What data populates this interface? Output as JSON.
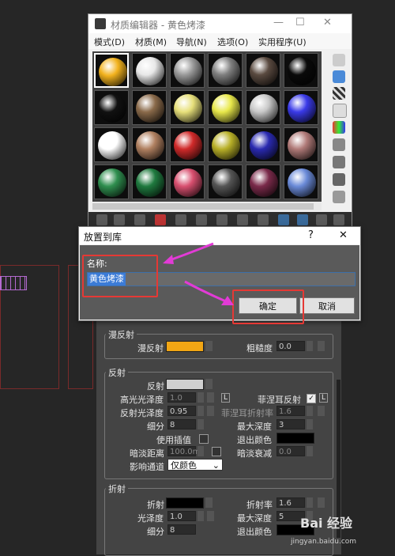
{
  "material_editor": {
    "title": "材质编辑器 - 黄色烤漆",
    "menu": [
      "模式(D)",
      "材质(M)",
      "导航(N)",
      "选项(O)",
      "实用程序(U)"
    ],
    "slots": [
      {
        "color": "#f2b21d",
        "selected": true
      },
      {
        "color": "#e8e8e8"
      },
      {
        "color": "#9a9a9a"
      },
      {
        "color": "#7f7f7f"
      },
      {
        "color": "#5a4a40"
      },
      {
        "color": "#0a0a0a"
      },
      {
        "color": "#111111"
      },
      {
        "color": "#8a6a4a"
      },
      {
        "color": "#e7e07a"
      },
      {
        "color": "#e8e84a"
      },
      {
        "color": "#c8c8c8"
      },
      {
        "color": "#3a3ae8"
      },
      {
        "color": "#ffffff"
      },
      {
        "color": "#b08060"
      },
      {
        "color": "#d02a2a"
      },
      {
        "color": "#b8b028"
      },
      {
        "color": "#2a2ab0"
      },
      {
        "color": "#b07a78"
      },
      {
        "color": "#2f8f4f"
      },
      {
        "color": "#1f7a3f"
      },
      {
        "color": "#d84f6f"
      },
      {
        "color": "#555555"
      },
      {
        "color": "#7a2a4a"
      },
      {
        "color": "#6a8ad8"
      }
    ]
  },
  "dialog": {
    "title": "放置到库",
    "help": "?",
    "close": "✕",
    "name_label": "名称:",
    "name_value": "黄色烤漆",
    "ok": "确定",
    "cancel": "取消"
  },
  "params": {
    "diffuse_group": {
      "title": "漫反射",
      "diffuse_label": "漫反射",
      "diffuse_color": "#f2a614",
      "roughness_label": "粗糙度",
      "roughness_value": "0.0"
    },
    "reflection_group": {
      "title": "反射",
      "reflect_label": "反射",
      "reflect_color": "#cfcfcf",
      "hilight_gloss_label": "高光光泽度",
      "hilight_gloss_value": "1.0",
      "fresnel_label": "菲涅耳反射",
      "refl_gloss_label": "反射光泽度",
      "refl_gloss_value": "0.95",
      "fresnel_ior_label": "菲涅耳折射率",
      "fresnel_ior_value": "1.6",
      "subdivs_label": "细分",
      "subdivs_value": "8",
      "max_depth_label": "最大深度",
      "max_depth_value": "3",
      "use_interp_label": "使用插值",
      "exit_color_label": "退出颜色",
      "dim_dist_label": "暗淡距离",
      "dim_dist_value": "100.0m",
      "dim_falloff_label": "暗淡衰减",
      "dim_falloff_value": "0.0",
      "affect_channels_label": "影响通道",
      "affect_channels_value": "仅颜色"
    },
    "refraction_group": {
      "title": "折射",
      "refract_label": "折射",
      "ior_label": "折射率",
      "ior_value": "1.6",
      "gloss_label": "光泽度",
      "gloss_value": "1.0",
      "max_depth_label": "最大深度",
      "max_depth_value": "5",
      "subdivs_label": "细分",
      "subdivs_value": "8",
      "exit_color_label": "退出颜色"
    },
    "lock_letter": "L"
  },
  "watermark": {
    "brand": "Bai 经验",
    "url": "jingyan.baidu.com"
  }
}
